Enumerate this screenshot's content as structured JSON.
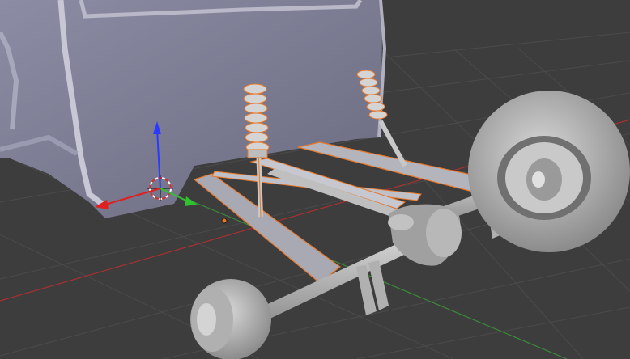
{
  "viewport": {
    "mode": "3d-viewport-solid-shading",
    "background_color": "#3d3d3d",
    "grid_color": "#4a4a4a",
    "selection_outline_color": "#e8782a",
    "axes": {
      "x_color": "#c83232",
      "y_color": "#3aa03a",
      "z_color": "#2a3aff"
    }
  },
  "scene": {
    "objects": [
      "car-body-door",
      "front-left-shock",
      "front-right-shock",
      "rear-axle-assembly",
      "front-wheel",
      "rear-wheel",
      "lower-control-arms",
      "differential"
    ]
  },
  "tools": {
    "cursor": "3d-cursor-icon",
    "manipulator": "transform-gizmo",
    "origin": "object-origin-point"
  }
}
